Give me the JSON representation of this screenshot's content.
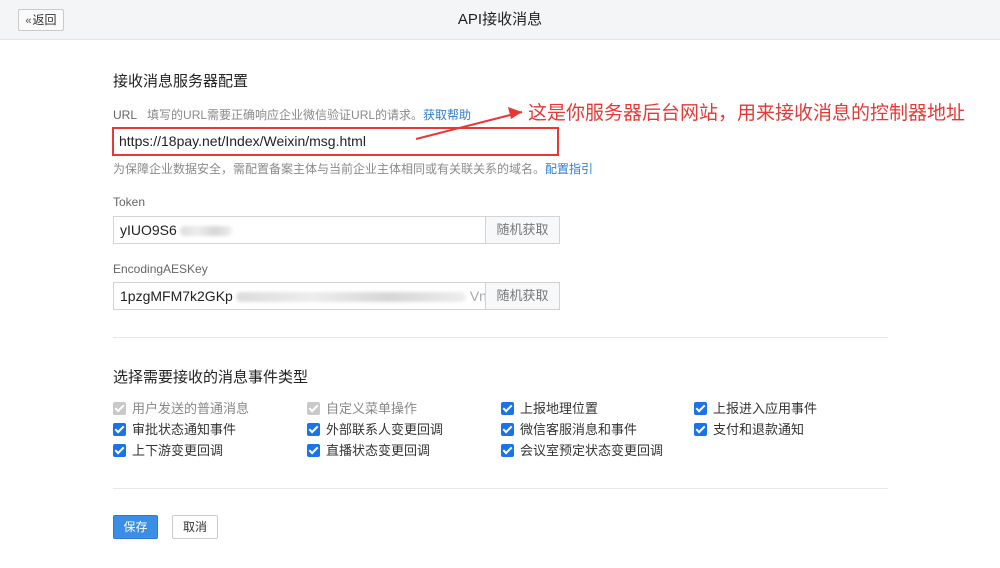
{
  "header": {
    "back_label": "返回",
    "title": "API接收消息"
  },
  "server_config": {
    "section_title": "接收消息服务器配置",
    "url": {
      "label": "URL",
      "hint": "填写的URL需要正确响应企业微信验证URL的请求。",
      "help_link": "获取帮助",
      "value": "https://18pay.net/Index/Weixin/msg.html",
      "notice": "为保障企业数据安全，需配置备案主体与当前企业主体相同或有关联关系的域名。",
      "notice_link": "配置指引"
    },
    "token": {
      "label": "Token",
      "value_visible": "yIUO9S6",
      "random_button": "随机获取"
    },
    "aes_key": {
      "label": "EncodingAESKey",
      "value_visible": "1pzgMFM7k2GKp",
      "value_tail": "Vn",
      "random_button": "随机获取"
    }
  },
  "annotation": {
    "text": "这是你服务器后台网站，用来接收消息的控制器地址",
    "color": "#e53935"
  },
  "events": {
    "section_title": "选择需要接收的消息事件类型",
    "items": [
      {
        "label": "用户发送的普通消息",
        "checked": true,
        "disabled": true
      },
      {
        "label": "自定义菜单操作",
        "checked": true,
        "disabled": true
      },
      {
        "label": "上报地理位置",
        "checked": true,
        "disabled": false
      },
      {
        "label": "上报进入应用事件",
        "checked": true,
        "disabled": false
      },
      {
        "label": "审批状态通知事件",
        "checked": true,
        "disabled": false
      },
      {
        "label": "外部联系人变更回调",
        "checked": true,
        "disabled": false
      },
      {
        "label": "微信客服消息和事件",
        "checked": true,
        "disabled": false
      },
      {
        "label": "支付和退款通知",
        "checked": true,
        "disabled": false
      },
      {
        "label": "上下游变更回调",
        "checked": true,
        "disabled": false
      },
      {
        "label": "直播状态变更回调",
        "checked": true,
        "disabled": false
      },
      {
        "label": "会议室预定状态变更回调",
        "checked": true,
        "disabled": false
      }
    ]
  },
  "actions": {
    "save_label": "保存",
    "cancel_label": "取消"
  },
  "colors": {
    "accent": "#1a73e8",
    "primary_button": "#3a8ee6",
    "highlight_border": "#e53935"
  }
}
